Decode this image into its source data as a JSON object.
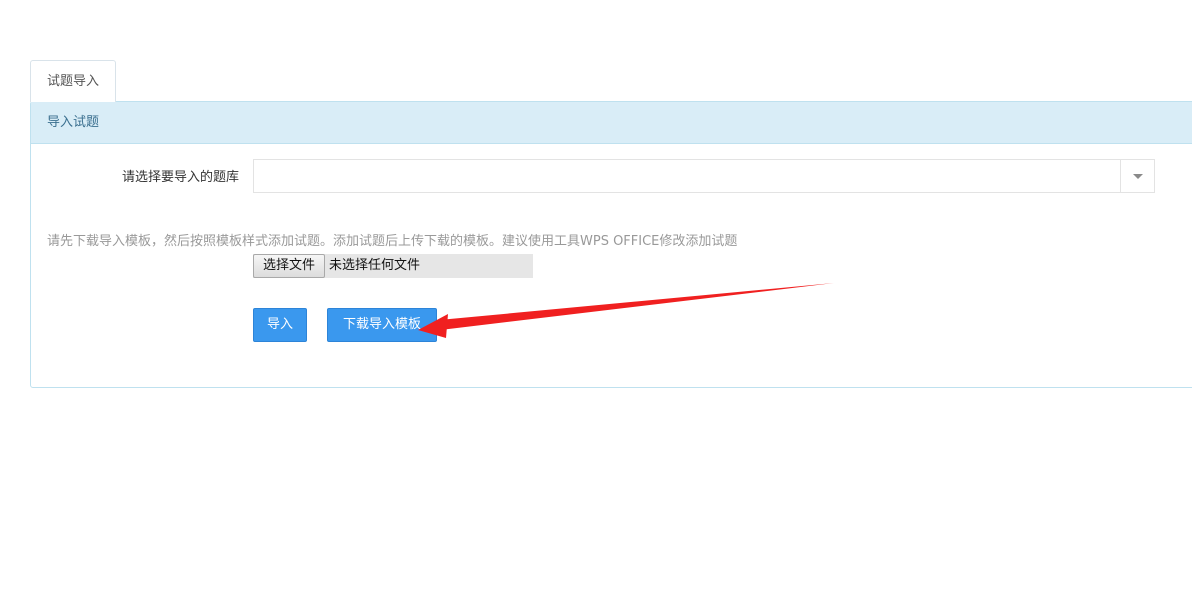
{
  "tabs": [
    {
      "label": "试题导入",
      "active": true
    }
  ],
  "panel": {
    "heading": "导入试题"
  },
  "form": {
    "bank_label": "请选择要导入的题库",
    "bank_selected": "",
    "hint": "请先下载导入模板，然后按照模板样式添加试题。添加试题后上传下载的模板。建议使用工具WPS OFFICE修改添加试题",
    "file_button_label": "选择文件",
    "file_status": "未选择任何文件",
    "import_button_label": "导入",
    "download_template_label": "下载导入模板"
  },
  "colors": {
    "primary_button": "#3a98ee",
    "panel_heading_bg": "#d9edf7",
    "annotation_arrow": "#f02020"
  },
  "icons": {
    "select_arrow": "caret-down-icon",
    "annotation": "red-arrow-annotation"
  }
}
